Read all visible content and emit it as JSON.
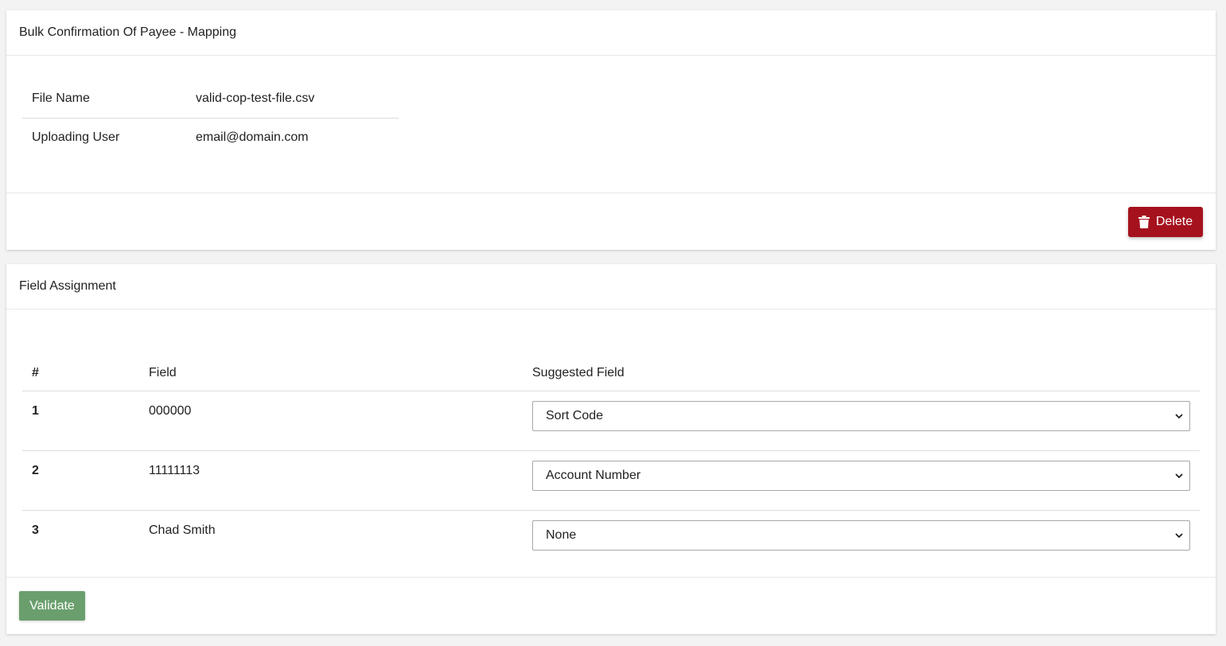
{
  "mapping_card": {
    "title": "Bulk Confirmation Of Payee - Mapping",
    "details": [
      {
        "label": "File Name",
        "value": "valid-cop-test-file.csv"
      },
      {
        "label": "Uploading User",
        "value": "email@domain.com"
      }
    ],
    "delete_label": "Delete",
    "delete_icon": "trash-icon",
    "delete_color": "#a5121e"
  },
  "assignment_card": {
    "title": "Field Assignment",
    "columns": [
      "#",
      "Field",
      "Suggested Field"
    ],
    "rows": [
      {
        "num": "1",
        "field": "000000",
        "suggested": "Sort Code"
      },
      {
        "num": "2",
        "field": "11111113",
        "suggested": "Account Number"
      },
      {
        "num": "3",
        "field": "Chad Smith",
        "suggested": "None"
      }
    ],
    "validate_label": "Validate",
    "validate_color": "#6a9f6d"
  }
}
